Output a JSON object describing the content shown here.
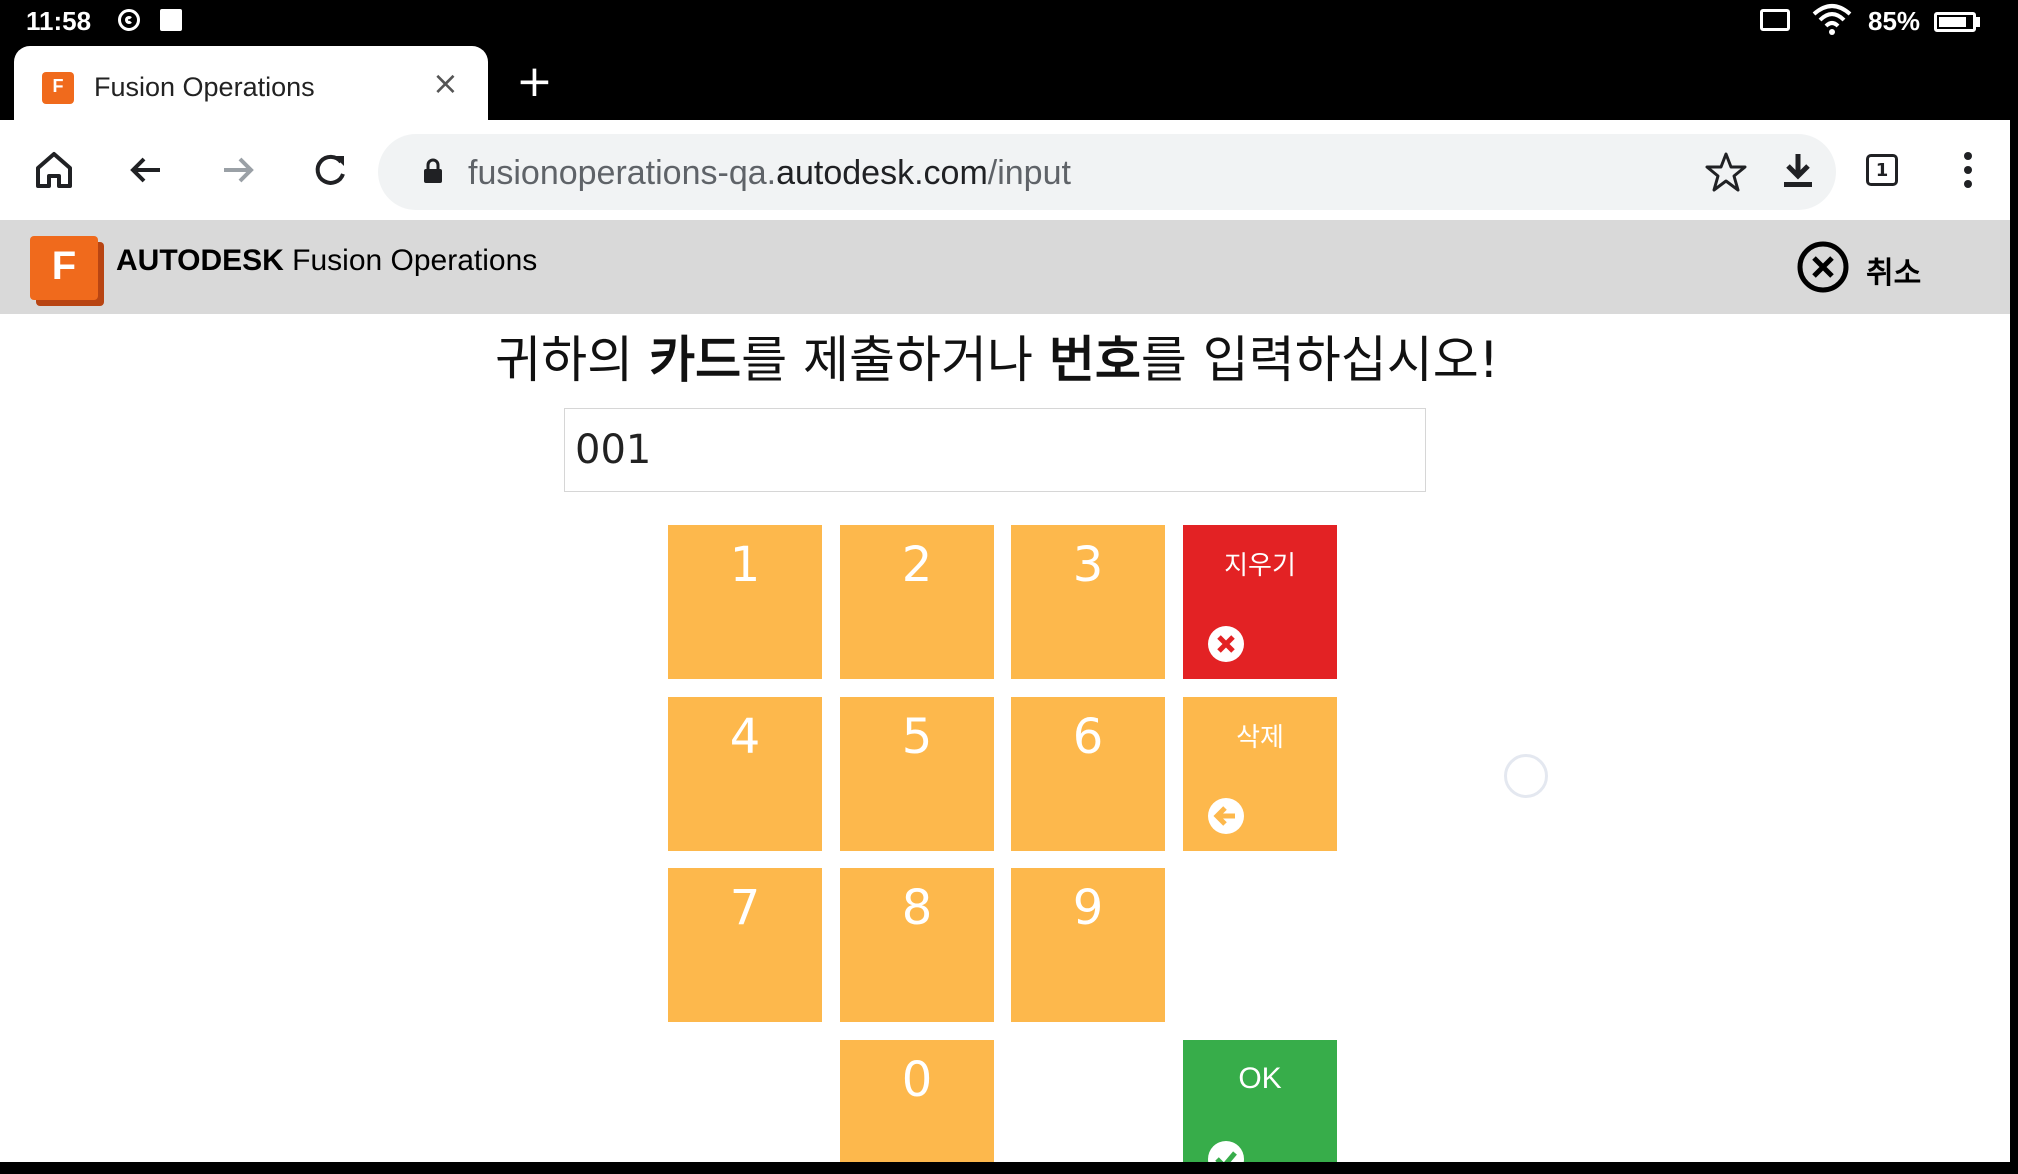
{
  "status_bar": {
    "time": "11:58",
    "battery_percent": "85%",
    "battery_level": 0.85
  },
  "tab": {
    "favicon_letter": "F",
    "title": "Fusion Operations",
    "close_glyph": "×"
  },
  "new_tab_glyph": "+",
  "toolbar": {
    "url_prefix": "fusionoperations-qa.",
    "url_domain": "autodesk.com",
    "url_path": "/input",
    "tab_count": "1"
  },
  "app": {
    "logo_letter": "F",
    "brand_bold": "AUTODESK",
    "brand_rest": " Fusion Operations",
    "cancel_label": "취소"
  },
  "prompt": {
    "part1": "귀하의 ",
    "bold1": "카드",
    "part2": "를 제출하거나 ",
    "bold2": "번호",
    "part3": "를 입력하십시오!"
  },
  "input": {
    "value": "001"
  },
  "keypad": {
    "digits": [
      "1",
      "2",
      "3",
      "4",
      "5",
      "6",
      "7",
      "8",
      "9",
      "0"
    ],
    "clear_label": "지우기",
    "delete_label": "삭제",
    "ok_label": "OK"
  },
  "colors": {
    "key": "#fdb84c",
    "clear": "#e32224",
    "ok": "#37ad4a",
    "brand": "#f06a1c"
  },
  "icons": [
    "home-icon",
    "back-icon",
    "forward-icon",
    "reload-icon",
    "lock-icon",
    "star-icon",
    "download-icon",
    "tabs-icon",
    "menu-icon",
    "cancel-circle-x-icon",
    "clear-x-icon",
    "backspace-arrow-icon",
    "ok-check-icon",
    "loading-spinner-icon"
  ]
}
